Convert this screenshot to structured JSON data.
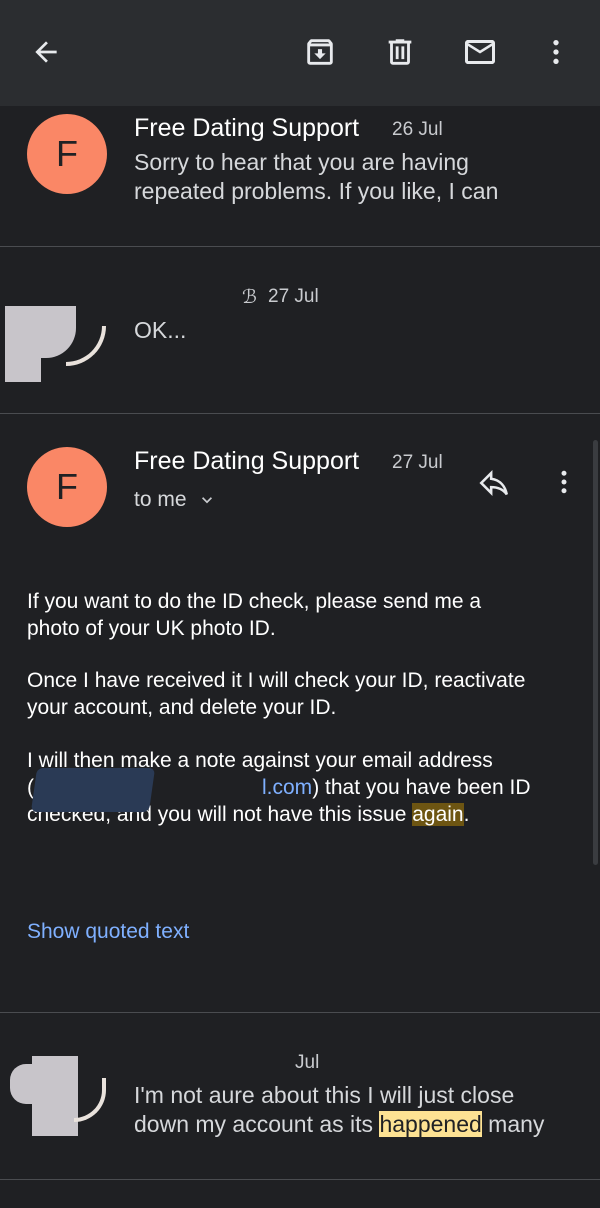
{
  "toolbar": {
    "icons": [
      "back-arrow-icon",
      "archive-icon",
      "delete-icon",
      "mark-unread-icon",
      "more-vert-icon"
    ]
  },
  "messages": [
    {
      "avatar_letter": "F",
      "sender": "Free Dating Support",
      "date": "26 Jul",
      "snippet_line1": "Sorry to hear that you are having",
      "snippet_line2": "repeated problems. If you like, I can"
    },
    {
      "sender": "ℬ",
      "date": "27 Jul",
      "snippet": "OK..."
    },
    {
      "avatar_letter": "F",
      "sender": "Free Dating Support",
      "date": "27 Jul",
      "recipient": "to me",
      "body_p1_line1": "If you want to do the ID check, please send me a",
      "body_p1_line2": "photo of your UK photo ID.",
      "body_p2_line1": "Once I have received it I will check your ID, reactivate",
      "body_p2_line2": "your account, and delete your ID.",
      "body_p3_line1": "I will then make a note against your email address",
      "body_p3_line2_open": "(",
      "body_p3_line2_link": "l.com",
      "body_p3_line2_rest": ") that you have been ID",
      "body_p3_line3_start": "checked, and you will not have this issue ",
      "body_p3_line3_highlight": "again",
      "body_p3_line3_end": ".",
      "show_quoted": "Show quoted text"
    },
    {
      "date": "Jul",
      "snippet_line1": "I'm not aure about this I will just close",
      "snippet_line2_start": "down my account as its ",
      "snippet_line2_highlight": "happened",
      "snippet_line2_end": " many"
    }
  ],
  "colors": {
    "avatar": "#fa8766",
    "link": "#7fb0ff",
    "highlight_dark": "#6d5512",
    "highlight_light": "#fde293"
  }
}
